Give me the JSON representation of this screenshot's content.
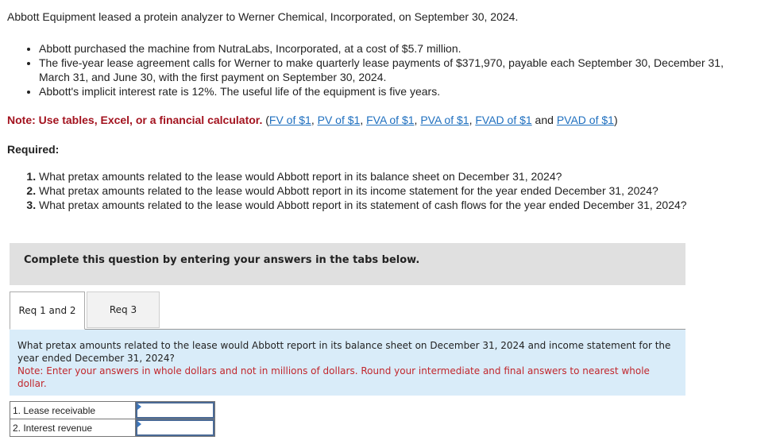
{
  "problem": {
    "intro": "Abbott Equipment leased a protein analyzer to Werner Chemical, Incorporated, on September 30, 2024.",
    "bullets": [
      "Abbott purchased the machine from NutraLabs, Incorporated, at a cost of $5.7 million.",
      "The five-year lease agreement calls for Werner to make quarterly lease payments of $371,970, payable each September 30, December 31, March 31, and June 30, with the first payment on September 30, 2024.",
      "Abbott's implicit interest rate is 12%. The useful life of the equipment is five years."
    ],
    "note_label": "Note: Use tables, Excel, or a financial calculator.",
    "note_open": " (",
    "links": [
      "FV of $1",
      "PV of $1",
      "FVA of $1",
      "PVA of $1",
      "FVAD of $1",
      "PVAD of $1"
    ],
    "sep_comma": ", ",
    "sep_and": " and ",
    "note_close": ")",
    "required_label": "Required:",
    "requirements": [
      "What pretax amounts related to the lease would Abbott report in its balance sheet on December 31, 2024?",
      "What pretax amounts related to the lease would Abbott report in its income statement for the year ended December 31, 2024?",
      "What pretax amounts related to the lease would Abbott report in its statement of cash flows for the year ended December 31, 2024?"
    ]
  },
  "instruction_box": "Complete this question by entering your answers in the tabs below.",
  "tabs": [
    {
      "label": "Req 1 and 2",
      "active": true
    },
    {
      "label": "Req 3",
      "active": false
    }
  ],
  "panel": {
    "question": "What pretax amounts related to the lease would Abbott report in its balance sheet on December 31, 2024 and income statement for the year ended December 31, 2024?",
    "note": "Note: Enter your answers in whole dollars and not in millions of dollars. Round your intermediate and final answers to nearest whole dollar."
  },
  "answers": [
    {
      "label": "1. Lease receivable",
      "value": ""
    },
    {
      "label": "2. Interest revenue",
      "value": ""
    }
  ],
  "colors": {
    "note_red": "#a3131f",
    "link_blue": "#1e6fbf",
    "panel_bg": "#d9ecf9",
    "panel_note_red": "#c1272d",
    "box_gray": "#e0e0e0"
  }
}
